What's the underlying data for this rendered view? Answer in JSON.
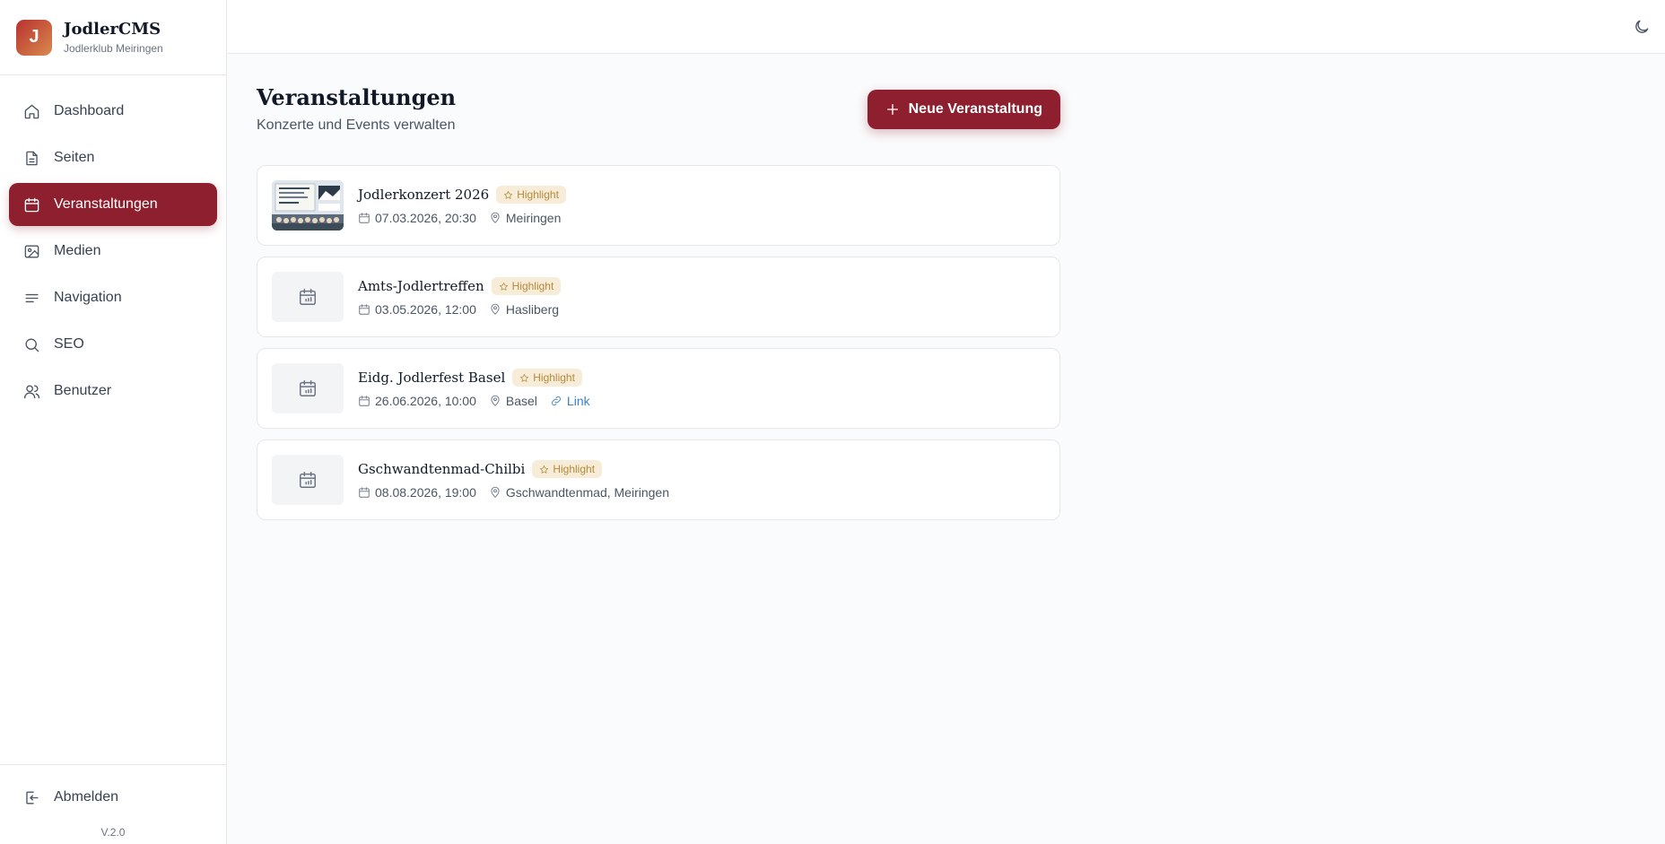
{
  "brand": {
    "logo_letter": "J",
    "name": "JodlerCMS",
    "subtitle": "Jodlerklub Meiringen"
  },
  "sidebar": {
    "items": [
      {
        "label": "Dashboard",
        "icon": "home-icon",
        "active": false
      },
      {
        "label": "Seiten",
        "icon": "file-icon",
        "active": false
      },
      {
        "label": "Veranstaltungen",
        "icon": "calendar-icon",
        "active": true
      },
      {
        "label": "Medien",
        "icon": "image-icon",
        "active": false
      },
      {
        "label": "Navigation",
        "icon": "menu-icon",
        "active": false
      },
      {
        "label": "SEO",
        "icon": "search-icon",
        "active": false
      },
      {
        "label": "Benutzer",
        "icon": "users-icon",
        "active": false
      }
    ],
    "logout_label": "Abmelden",
    "version": "V.2.0"
  },
  "topbar": {
    "theme_icon": "moon-icon"
  },
  "page": {
    "title": "Veranstaltungen",
    "subtitle": "Konzerte und Events verwalten",
    "new_button_label": "Neue Veranstaltung"
  },
  "events": [
    {
      "title": "Jodlerkonzert 2026",
      "badge": "Highlight",
      "datetime": "07.03.2026, 20:30",
      "location": "Meiringen",
      "link": "",
      "has_image": true
    },
    {
      "title": "Amts-Jodlertreffen",
      "badge": "Highlight",
      "datetime": "03.05.2026, 12:00",
      "location": "Hasliberg",
      "link": "",
      "has_image": false
    },
    {
      "title": "Eidg. Jodlerfest Basel",
      "badge": "Highlight",
      "datetime": "26.06.2026, 10:00",
      "location": "Basel",
      "link": "Link",
      "has_image": false
    },
    {
      "title": "Gschwandtenmad-Chilbi",
      "badge": "Highlight",
      "datetime": "08.08.2026, 19:00",
      "location": "Gschwandtenmad, Meiringen",
      "link": "",
      "has_image": false
    }
  ],
  "colors": {
    "primary": "#8e1f2f",
    "badge_bg": "#f6ecd8",
    "badge_text": "#b58a3a",
    "link": "#3b82c4"
  }
}
